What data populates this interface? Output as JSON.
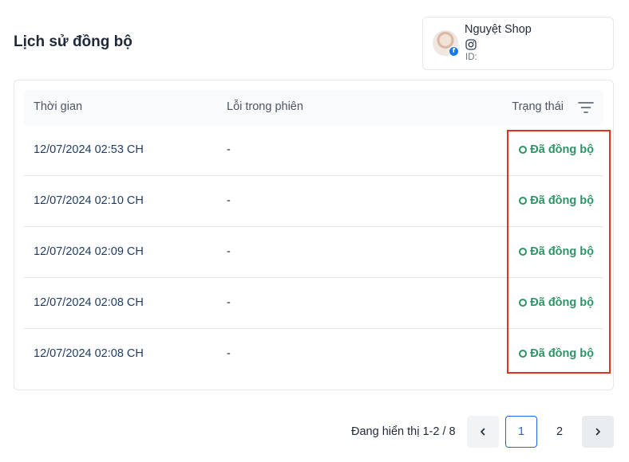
{
  "page": {
    "title": "Lịch sử đồng bộ"
  },
  "shop": {
    "name": "Nguyệt Shop",
    "id_label": "ID:",
    "platform_badge": "f"
  },
  "table": {
    "columns": {
      "time": "Thời gian",
      "error": "Lỗi trong phiên",
      "status": "Trạng thái"
    },
    "rows": [
      {
        "time": "12/07/2024 02:53 CH",
        "error": "-",
        "status": "Đã đồng bộ"
      },
      {
        "time": "12/07/2024 02:10 CH",
        "error": "-",
        "status": "Đã đồng bộ"
      },
      {
        "time": "12/07/2024 02:09 CH",
        "error": "-",
        "status": "Đã đồng bộ"
      },
      {
        "time": "12/07/2024 02:08 CH",
        "error": "-",
        "status": "Đã đồng bộ"
      },
      {
        "time": "12/07/2024 02:08 CH",
        "error": "-",
        "status": "Đã đồng bộ"
      }
    ]
  },
  "pagination": {
    "info": "Đang hiển thị 1-2 / 8",
    "pages": [
      "1",
      "2"
    ],
    "current": "1"
  },
  "colors": {
    "status_green": "#2e9466",
    "highlight_red": "#e0321c",
    "active_page_blue": "#2563eb"
  },
  "icons": {
    "filter": "filter-icon",
    "instagram": "instagram-icon",
    "facebook": "facebook-icon",
    "prev": "chevron-left-icon",
    "next": "chevron-right-icon"
  }
}
